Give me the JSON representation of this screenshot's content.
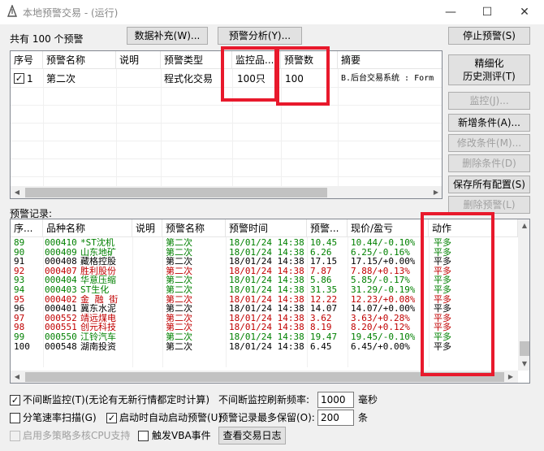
{
  "window": {
    "title": "本地预警交易 - (运行)",
    "minimize": "—",
    "maximize": "☐",
    "close": "✕"
  },
  "toolbar": {
    "summary": "共有 100 个预警",
    "data_supplement": "数据补充(W)...",
    "alert_analysis": "预警分析(Y)...",
    "stop_alert": "停止预警(S)"
  },
  "alerts_table": {
    "headers": [
      "序号",
      "预警名称",
      "说明",
      "预警类型",
      "监控品...",
      "预警数",
      "摘要"
    ],
    "row": {
      "checked": "✓",
      "index": "1",
      "name": "第二次",
      "desc": "",
      "type": "程式化交易",
      "monitor": "100只",
      "count": "100",
      "summary": "B.后台交易系统 : Form"
    }
  },
  "side_buttons": {
    "backtest_line1": "精细化",
    "backtest_line2": "历史测评(T)",
    "monitor": "监控(J)...",
    "add_condition": "新增条件(A)...",
    "modify_condition": "修改条件(M)...",
    "delete_condition": "删除条件(D)",
    "save_config": "保存所有配置(S)",
    "delete_alert": "删除预警(L)"
  },
  "records": {
    "label": "预警记录:",
    "headers": [
      "序...",
      "品种名称",
      "说明",
      "预警名称",
      "预警时间",
      "预警...",
      "现价/盈亏",
      "动作"
    ],
    "rows": [
      {
        "seq": "89",
        "code": "000410",
        "name": "*ST沈机",
        "alert": "第二次",
        "time": "18/01/24 14:38",
        "price": "10.45",
        "pnl": "10.44/-0.10%",
        "action": "平多",
        "color": "green"
      },
      {
        "seq": "90",
        "code": "000409",
        "name": "山东地矿",
        "alert": "第二次",
        "time": "18/01/24 14:38",
        "price": "6.26",
        "pnl": "6.25/-0.16%",
        "action": "平多",
        "color": "green"
      },
      {
        "seq": "91",
        "code": "000408",
        "name": "藏格控股",
        "alert": "第二次",
        "time": "18/01/24 14:38",
        "price": "17.15",
        "pnl": "17.15/+0.00%",
        "action": "平多",
        "color": "black"
      },
      {
        "seq": "92",
        "code": "000407",
        "name": "胜利股份",
        "alert": "第二次",
        "time": "18/01/24 14:38",
        "price": "7.87",
        "pnl": "7.88/+0.13%",
        "action": "平多",
        "color": "red"
      },
      {
        "seq": "93",
        "code": "000404",
        "name": "华意压缩",
        "alert": "第二次",
        "time": "18/01/24 14:38",
        "price": "5.86",
        "pnl": "5.85/-0.17%",
        "action": "平多",
        "color": "green"
      },
      {
        "seq": "94",
        "code": "000403",
        "name": "ST生化",
        "alert": "第二次",
        "time": "18/01/24 14:38",
        "price": "31.35",
        "pnl": "31.29/-0.19%",
        "action": "平多",
        "color": "green"
      },
      {
        "seq": "95",
        "code": "000402",
        "name": "金 融 街",
        "alert": "第二次",
        "time": "18/01/24 14:38",
        "price": "12.22",
        "pnl": "12.23/+0.08%",
        "action": "平多",
        "color": "red"
      },
      {
        "seq": "96",
        "code": "000401",
        "name": "冀东水泥",
        "alert": "第二次",
        "time": "18/01/24 14:38",
        "price": "14.07",
        "pnl": "14.07/+0.00%",
        "action": "平多",
        "color": "black"
      },
      {
        "seq": "97",
        "code": "000552",
        "name": "靖远煤电",
        "alert": "第二次",
        "time": "18/01/24 14:38",
        "price": "3.62",
        "pnl": "3.63/+0.28%",
        "action": "平多",
        "color": "red"
      },
      {
        "seq": "98",
        "code": "000551",
        "name": "创元科技",
        "alert": "第二次",
        "time": "18/01/24 14:38",
        "price": "8.19",
        "pnl": "8.20/+0.12%",
        "action": "平多",
        "color": "red"
      },
      {
        "seq": "99",
        "code": "000550",
        "name": "江铃汽车",
        "alert": "第二次",
        "time": "18/01/24 14:38",
        "price": "19.47",
        "pnl": "19.45/-0.10%",
        "action": "平多",
        "color": "green"
      },
      {
        "seq": "100",
        "code": "000548",
        "name": "湖南投资",
        "alert": "第二次",
        "time": "18/01/24 14:38",
        "price": "6.45",
        "pnl": "6.45/+0.00%",
        "action": "平多",
        "color": "black"
      }
    ]
  },
  "options": {
    "continuous_monitor": "不间断监控(T)(无论有无新行情都定时计算)",
    "continuous_checked": "✓",
    "refresh_label": "不间断监控刷新频率:",
    "refresh_value": "1000",
    "refresh_unit": "毫秒",
    "tick_scan": "分笔速率扫描(G)",
    "auto_start": "启动时自动启动预警(U)",
    "auto_checked": "✓",
    "keep_label": "预警记录最多保留(O):",
    "keep_value": "200",
    "keep_unit": "条",
    "multi_cpu": "启用多策略多核CPU支持",
    "vba_event": "触发VBA事件",
    "view_log": "查看交易日志"
  }
}
